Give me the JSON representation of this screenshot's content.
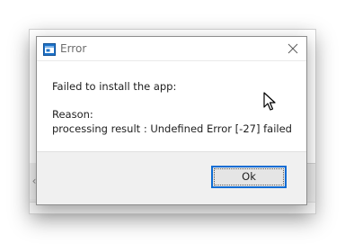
{
  "dialog": {
    "title": "Error",
    "title_icon": "app-window-icon",
    "close_icon": "close-icon",
    "message_line1": "Failed to install the app:",
    "reason_label": "Reason:",
    "reason_detail": "processing result : Undefined Error [-27] failed",
    "ok_label": "Ok"
  },
  "background_window": {
    "scroll_glyph": "‹"
  },
  "colors": {
    "accent": "#0c6cd4",
    "footer_bg": "#f0f0f0",
    "title_text": "#6d6d6d"
  }
}
